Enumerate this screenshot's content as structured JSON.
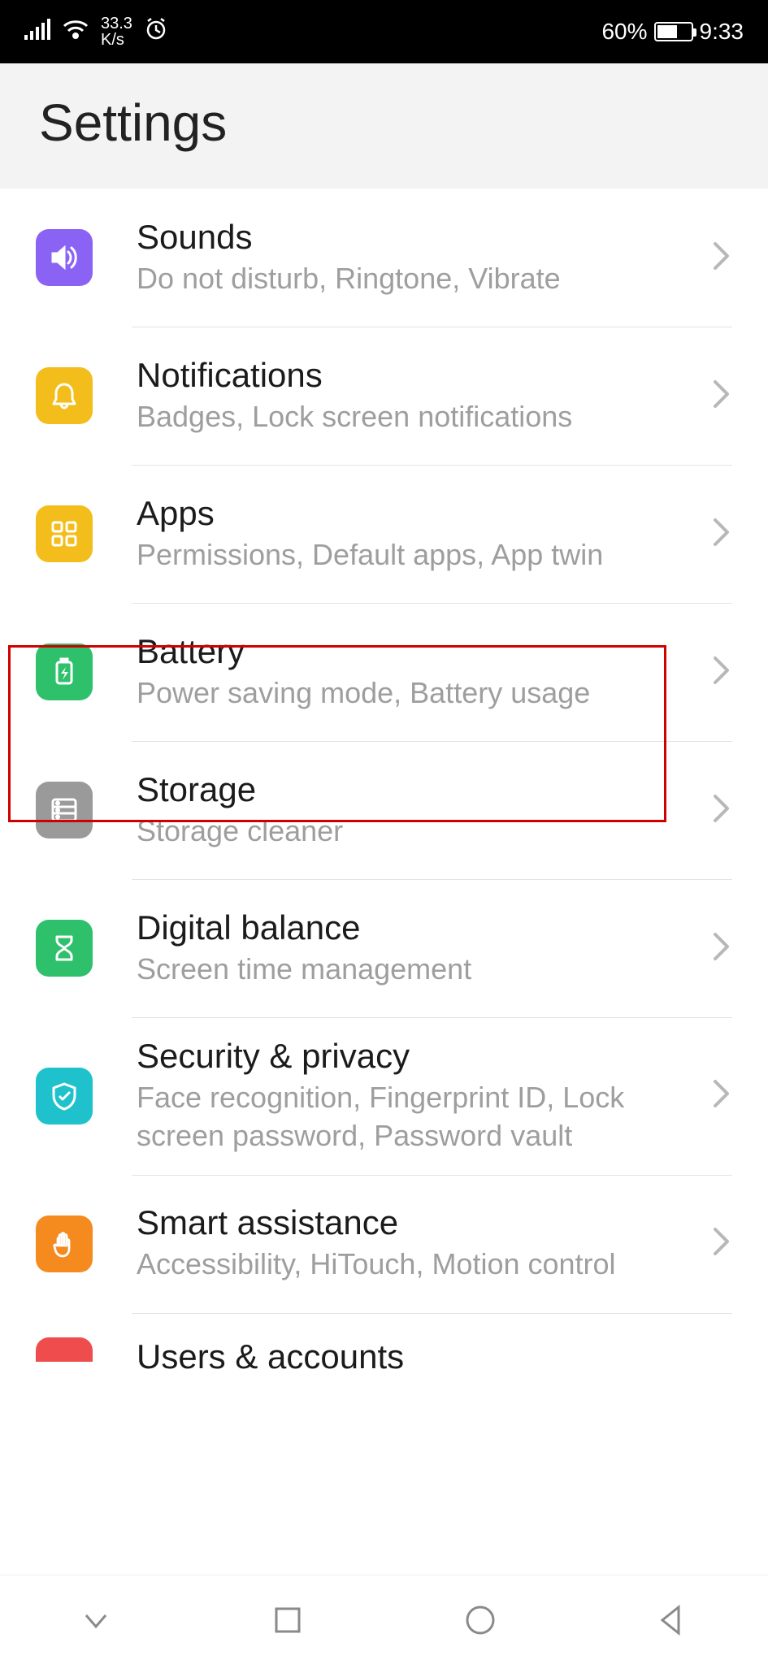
{
  "statusbar": {
    "network_rate_top": "33.3",
    "network_rate_bottom": "K/s",
    "battery_percent_text": "60%",
    "battery_fill_percent": 60,
    "time": "9:33"
  },
  "header": {
    "title": "Settings"
  },
  "highlight": {
    "target_item_index": 2
  },
  "items": [
    {
      "key": "sounds",
      "title": "Sounds",
      "subtitle": "Do not disturb, Ringtone, Vibrate",
      "icon": "volume",
      "color": "#8b63f4"
    },
    {
      "key": "notifications",
      "title": "Notifications",
      "subtitle": "Badges, Lock screen notifications",
      "icon": "bell",
      "color": "#f3bd1b"
    },
    {
      "key": "apps",
      "title": "Apps",
      "subtitle": "Permissions, Default apps, App twin",
      "icon": "grid",
      "color": "#f3bd1b"
    },
    {
      "key": "battery",
      "title": "Battery",
      "subtitle": "Power saving mode, Battery usage",
      "icon": "battery",
      "color": "#2fc06b"
    },
    {
      "key": "storage",
      "title": "Storage",
      "subtitle": "Storage cleaner",
      "icon": "storage",
      "color": "#9a9a9a"
    },
    {
      "key": "digital_balance",
      "title": "Digital balance",
      "subtitle": "Screen time management",
      "icon": "hourglass",
      "color": "#2fc06b"
    },
    {
      "key": "security",
      "title": "Security & privacy",
      "subtitle": "Face recognition, Fingerprint ID, Lock screen password, Password vault",
      "icon": "shield",
      "color": "#1fc2cc"
    },
    {
      "key": "smart_assistance",
      "title": "Smart assistance",
      "subtitle": "Accessibility, HiTouch, Motion control",
      "icon": "hand",
      "color": "#f58a1f"
    },
    {
      "key": "users_accounts",
      "title": "Users & accounts",
      "subtitle": "",
      "icon": "cutoff",
      "color": "#ef4d4d"
    }
  ]
}
